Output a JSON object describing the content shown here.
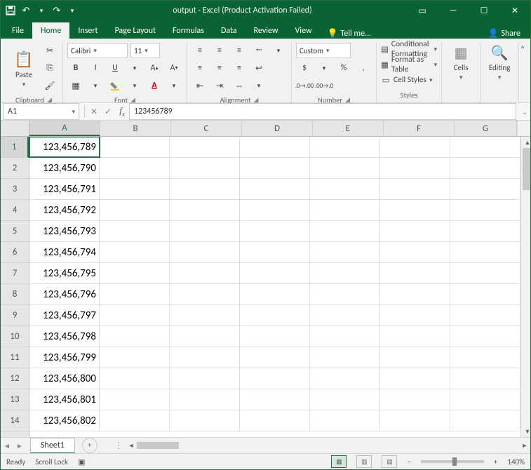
{
  "titlebar": {
    "title": "output - Excel (Product Activation Failed)"
  },
  "tabs": {
    "file": "File",
    "home": "Home",
    "insert": "Insert",
    "page_layout": "Page Layout",
    "formulas": "Formulas",
    "data": "Data",
    "review": "Review",
    "view": "View",
    "tellme": "Tell me...",
    "share": "Share"
  },
  "ribbon": {
    "clipboard": {
      "label": "Clipboard",
      "paste": "Paste"
    },
    "font": {
      "label": "Font",
      "name": "Calibri",
      "size": "11"
    },
    "alignment": {
      "label": "Alignment"
    },
    "number": {
      "label": "Number",
      "format": "Custom"
    },
    "styles": {
      "label": "Styles",
      "conditional": "Conditional Formatting",
      "table": "Format as Table",
      "cellstyles": "Cell Styles"
    },
    "cells": {
      "label": "Cells",
      "btn": "Cells"
    },
    "editing": {
      "label": "Editing",
      "btn": "Editing"
    }
  },
  "formulabar": {
    "namebox": "A1",
    "formula": "123456789"
  },
  "grid": {
    "columns": [
      "A",
      "B",
      "C",
      "D",
      "E",
      "F",
      "G"
    ],
    "selected_col_index": 0,
    "selected_row_index": 0,
    "rows": [
      {
        "num": "1",
        "A": "123,456,789"
      },
      {
        "num": "2",
        "A": "123,456,790"
      },
      {
        "num": "3",
        "A": "123,456,791"
      },
      {
        "num": "4",
        "A": "123,456,792"
      },
      {
        "num": "5",
        "A": "123,456,793"
      },
      {
        "num": "6",
        "A": "123,456,794"
      },
      {
        "num": "7",
        "A": "123,456,795"
      },
      {
        "num": "8",
        "A": "123,456,796"
      },
      {
        "num": "9",
        "A": "123,456,797"
      },
      {
        "num": "10",
        "A": "123,456,798"
      },
      {
        "num": "11",
        "A": "123,456,799"
      },
      {
        "num": "12",
        "A": "123,456,800"
      },
      {
        "num": "13",
        "A": "123,456,801"
      },
      {
        "num": "14",
        "A": "123,456,802"
      }
    ]
  },
  "sheettabs": {
    "sheet1": "Sheet1"
  },
  "statusbar": {
    "ready": "Ready",
    "scroll_lock": "Scroll Lock",
    "zoom": "140%",
    "zoom_minus": "−",
    "zoom_plus": "+"
  }
}
